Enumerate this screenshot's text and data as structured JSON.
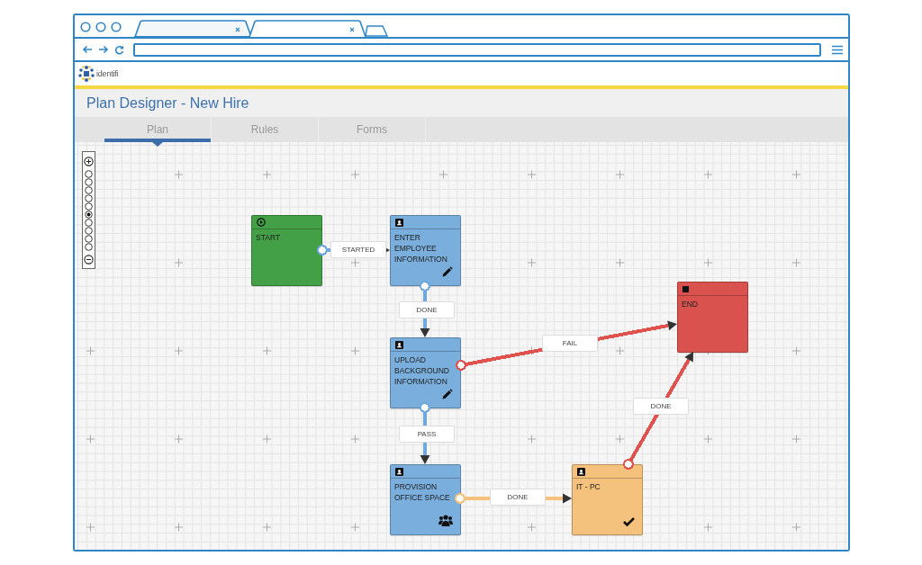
{
  "browser": {
    "tabs": [
      {
        "selected": false
      },
      {
        "selected": true
      }
    ]
  },
  "app": {
    "logo_text": "identifi",
    "title": "Plan Designer - New Hire"
  },
  "tabs": [
    {
      "label": "Plan",
      "selected": true
    },
    {
      "label": "Rules",
      "selected": false
    },
    {
      "label": "Forms",
      "selected": false
    }
  ],
  "zoom": {
    "steps": [
      {
        "selected": false
      },
      {
        "selected": false
      },
      {
        "selected": false
      },
      {
        "selected": false
      },
      {
        "selected": false
      },
      {
        "selected": true
      },
      {
        "selected": false
      },
      {
        "selected": false
      },
      {
        "selected": false
      },
      {
        "selected": false
      }
    ]
  },
  "nodes": [
    {
      "kind": "start",
      "label": "START",
      "color": "#43a047"
    },
    {
      "kind": "task",
      "label": "ENTER\nEMPLOYEE\nINFORMATION",
      "color": "#7aaedc",
      "action": {
        "kind": "edit"
      }
    },
    {
      "kind": "task",
      "label": "UPLOAD\nBACKGROUND\nINFORMATION",
      "color": "#7aaedc",
      "action": {
        "kind": "edit"
      }
    },
    {
      "kind": "task",
      "label": "PROVISION\nOFFICE SPACE",
      "color": "#7aaedc",
      "action": {
        "kind": "group"
      }
    },
    {
      "kind": "task",
      "label": "IT - PC",
      "color": "#f4c27c",
      "action": {
        "kind": "check"
      }
    },
    {
      "kind": "end",
      "label": "END",
      "color": "#da524d"
    }
  ],
  "edges": [
    {
      "label": "STARTED",
      "color": "#6fa8dc"
    },
    {
      "label": "DONE",
      "color": "#6fa8dc"
    },
    {
      "label": "FAIL",
      "color": "#e0524d"
    },
    {
      "label": "PASS",
      "color": "#6fa8dc"
    },
    {
      "label": "DONE",
      "color": "#f4c27c"
    },
    {
      "label": "DONE",
      "color": "#e0524d"
    }
  ]
}
